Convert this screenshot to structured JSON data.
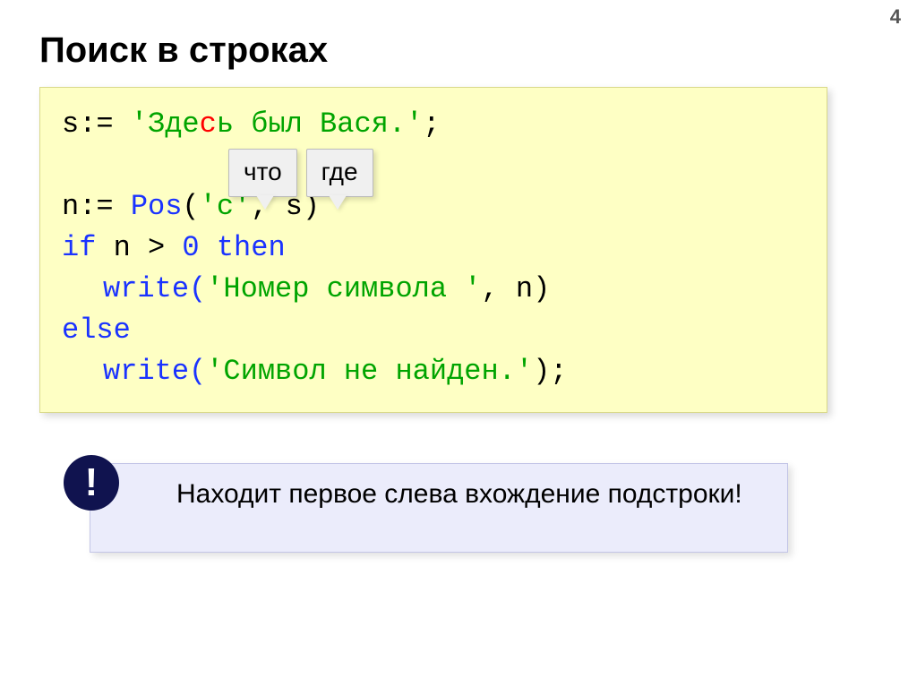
{
  "page_number": "4",
  "title": "Поиск в строках",
  "code": {
    "l1_lhs": "s:= ",
    "l1_q1": "'",
    "l1_pre": "Зде",
    "l1_hl": "с",
    "l1_post": "ь был Вася.",
    "l1_q2": "'",
    "l1_end": ";",
    "l3_pre": "n:= ",
    "l3_fn": "Pos",
    "l3_open": "(",
    "l3_arg1": "'с'",
    "l3_mid": ", s)",
    "l4_a": "if ",
    "l4_b": "n > ",
    "l4_c": "0",
    "l4_d": " then",
    "l5_a": "write(",
    "l5_b": "'Номер символа '",
    "l5_c": ", n)",
    "l6": "else",
    "l7_a": "write(",
    "l7_b": "'Символ не найден.'",
    "l7_c": ");"
  },
  "bubbles": {
    "what": "что",
    "where": "где"
  },
  "info": {
    "mark": "!",
    "text": "Находит первое слева вхождение подстроки!"
  }
}
